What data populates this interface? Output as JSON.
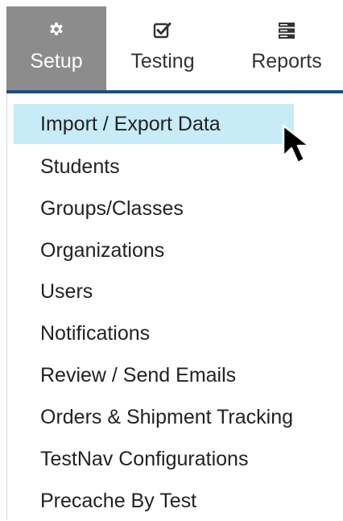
{
  "nav": {
    "tabs": [
      {
        "label": "Setup",
        "icon": "gear-icon",
        "active": true
      },
      {
        "label": "Testing",
        "icon": "checkbox-icon",
        "active": false
      },
      {
        "label": "Reports",
        "icon": "server-stack-icon",
        "active": false
      }
    ],
    "active_color": "#8c8c8c",
    "underline_color": "#1c4e80"
  },
  "menu": {
    "items": [
      {
        "label": "Import / Export Data",
        "highlighted": true
      },
      {
        "label": "Students"
      },
      {
        "label": "Groups/Classes"
      },
      {
        "label": "Organizations"
      },
      {
        "label": "Users"
      },
      {
        "label": "Notifications"
      },
      {
        "label": "Review / Send Emails"
      },
      {
        "label": "Orders & Shipment Tracking"
      },
      {
        "label": "TestNav Configurations"
      },
      {
        "label": "Precache By Test"
      }
    ],
    "highlight_color": "#c7ecf8"
  },
  "cursor": {
    "icon": "mouse-pointer-icon"
  }
}
